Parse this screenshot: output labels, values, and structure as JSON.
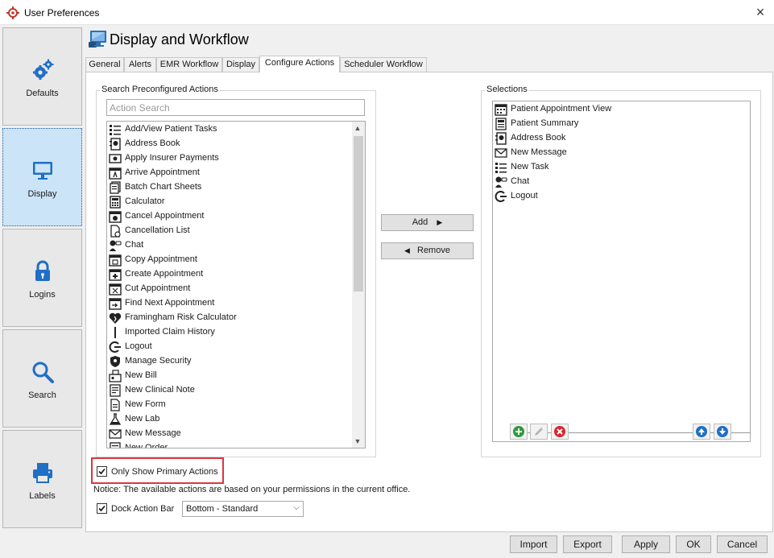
{
  "window": {
    "title": "User Preferences",
    "close_glyph": "×"
  },
  "sidebar": {
    "items": [
      {
        "label": "Defaults",
        "icon": "gears-icon"
      },
      {
        "label": "Display",
        "icon": "monitor-icon",
        "active": true
      },
      {
        "label": "Logins",
        "icon": "lock-icon"
      },
      {
        "label": "Search",
        "icon": "magnifier-icon"
      },
      {
        "label": "Labels",
        "icon": "printer-icon"
      }
    ]
  },
  "header": {
    "title": "Display and Workflow"
  },
  "tabs": [
    {
      "label": "General"
    },
    {
      "label": "Alerts"
    },
    {
      "label": "EMR Workflow"
    },
    {
      "label": "Display"
    },
    {
      "label": "Configure Actions",
      "active": true
    },
    {
      "label": "Scheduler Workflow"
    }
  ],
  "search_group": {
    "title": "Search Preconfigured Actions",
    "search_placeholder": "Action Search",
    "items": [
      {
        "label": "Add/View Patient Tasks",
        "icon": "task-list-icon"
      },
      {
        "label": "Address Book",
        "icon": "address-book-icon"
      },
      {
        "label": "Apply Insurer Payments",
        "icon": "payments-icon"
      },
      {
        "label": "Arrive Appointment",
        "icon": "arrive-appointment-icon"
      },
      {
        "label": "Batch Chart Sheets",
        "icon": "chart-sheets-icon"
      },
      {
        "label": "Calculator",
        "icon": "calculator-icon"
      },
      {
        "label": "Cancel Appointment",
        "icon": "cancel-appointment-icon"
      },
      {
        "label": "Cancellation List",
        "icon": "cancellation-list-icon"
      },
      {
        "label": "Chat",
        "icon": "chat-icon"
      },
      {
        "label": "Copy Appointment",
        "icon": "copy-appointment-icon"
      },
      {
        "label": "Create Appointment",
        "icon": "create-appointment-icon"
      },
      {
        "label": "Cut Appointment",
        "icon": "cut-appointment-icon"
      },
      {
        "label": "Find Next Appointment",
        "icon": "find-next-appointment-icon"
      },
      {
        "label": "Framingham Risk Calculator",
        "icon": "heart-icon"
      },
      {
        "label": "Imported Claim History",
        "icon": "claim-history-icon"
      },
      {
        "label": "Logout",
        "icon": "logout-icon"
      },
      {
        "label": "Manage Security",
        "icon": "shield-icon"
      },
      {
        "label": "New Bill",
        "icon": "bill-icon"
      },
      {
        "label": "New Clinical Note",
        "icon": "clinical-note-icon"
      },
      {
        "label": "New Form",
        "icon": "form-icon"
      },
      {
        "label": "New Lab",
        "icon": "flask-icon"
      },
      {
        "label": "New Message",
        "icon": "envelope-icon"
      },
      {
        "label": "New Order",
        "icon": "order-icon"
      }
    ]
  },
  "buttons": {
    "add": "Add",
    "remove": "Remove"
  },
  "selections_group": {
    "title": "Selections",
    "items": [
      {
        "label": "Patient Appointment View",
        "icon": "calendar-icon"
      },
      {
        "label": "Patient Summary",
        "icon": "summary-icon"
      },
      {
        "label": "Address Book",
        "icon": "address-book-icon"
      },
      {
        "label": "New Message",
        "icon": "envelope-icon"
      },
      {
        "label": "New Task",
        "icon": "task-list-icon"
      },
      {
        "label": "Chat",
        "icon": "chat-icon"
      },
      {
        "label": "Logout",
        "icon": "logout-icon"
      }
    ]
  },
  "options": {
    "only_primary_label": "Only Show Primary Actions",
    "only_primary_checked": true,
    "notice": "Notice: The available actions are based on your permissions in the current office.",
    "dock_label": "Dock Action Bar",
    "dock_checked": true,
    "dock_value": "Bottom - Standard"
  },
  "footer": {
    "import": "Import",
    "export": "Export",
    "apply": "Apply",
    "ok": "OK",
    "cancel": "Cancel"
  },
  "colors": {
    "accent": "#0a64c8",
    "highlight": "#e0343f",
    "active_side": "#cce4f7"
  }
}
